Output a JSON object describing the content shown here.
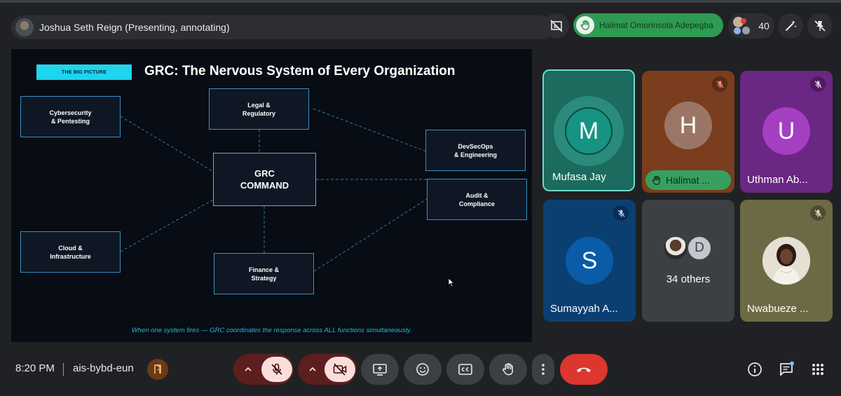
{
  "topbar": {
    "presenter_label": "Joshua Seth Reign (Presenting, annotating)",
    "raised_hand_name": "Halimat Omorinsola Adepegba",
    "participant_count": "40"
  },
  "slide": {
    "tag": "THE BIG PICTURE",
    "title": "GRC: The Nervous System of Every Organization",
    "nodes": {
      "cyber": "Cybersecurity\n& Pentesting",
      "legal": "Legal &\nRegulatory",
      "devsecops": "DevSecOps\n& Engineering",
      "center": "GRC\nCOMMAND",
      "audit": "Audit &\nCompliance",
      "cloud": "Cloud &\nInfrastructure",
      "finance": "Finance &\nStrategy"
    },
    "footer": "When one system fires — GRC coordinates the response across ALL functions simultaneously."
  },
  "tiles": [
    {
      "initial": "M",
      "name": "Mufasa Jay"
    },
    {
      "initial": "H",
      "name": "Halimat ..."
    },
    {
      "initial": "U",
      "name": "Uthman Ab..."
    },
    {
      "initial": "S",
      "name": "Sumayyah A..."
    },
    {
      "initial": "D",
      "name": "34 others"
    },
    {
      "name": "Nwabueze ..."
    }
  ],
  "bottombar": {
    "time": "8:20 PM",
    "meeting_code": "ais-bybd-eun"
  },
  "colors": {
    "accent_cyan": "#1fd4ee",
    "hand_green": "#2f9a52",
    "leave_red": "#dc362e"
  }
}
